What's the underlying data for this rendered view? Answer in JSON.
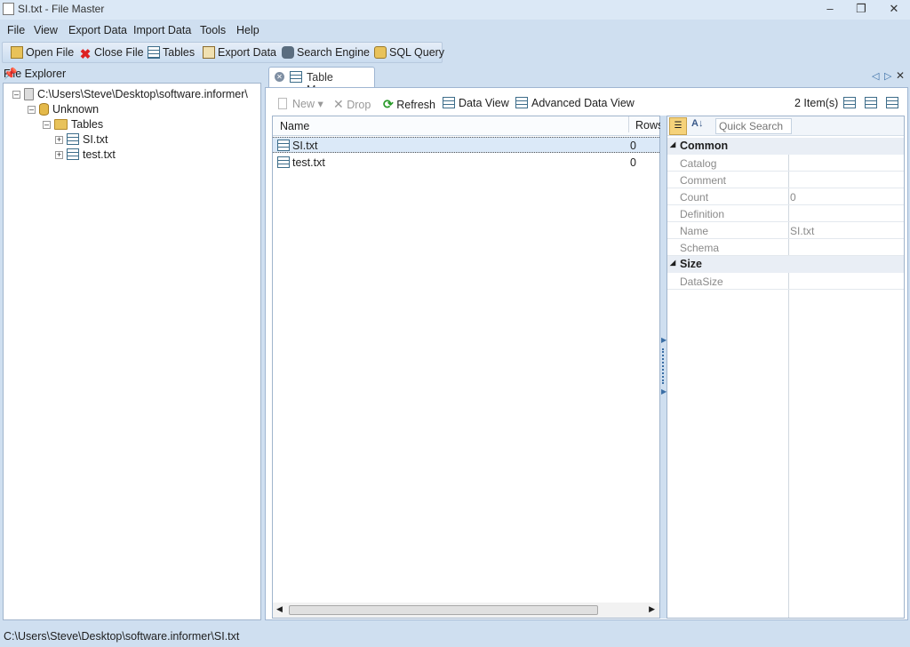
{
  "window": {
    "title": "SI.txt - File Master"
  },
  "menu": [
    "File",
    "View",
    "Export Data",
    "Import Data",
    "Tools",
    "Help"
  ],
  "toolbar": {
    "open_file": "Open File",
    "close_file": "Close File",
    "tables": "Tables",
    "export_data": "Export Data",
    "search_engine": "Search Engine",
    "sql_query": "SQL Query"
  },
  "file_explorer": {
    "title": "File Explorer",
    "root": "C:\\Users\\Steve\\Desktop\\software.informer\\",
    "db": "Unknown",
    "folder": "Tables",
    "items": [
      "SI.txt",
      "test.txt"
    ]
  },
  "tab": {
    "label": "Table Manager"
  },
  "subtoolbar": {
    "new": "New",
    "drop": "Drop",
    "refresh": "Refresh",
    "data_view": "Data View",
    "advanced_data_view": "Advanced Data View",
    "count": "2 Item(s)"
  },
  "grid": {
    "columns": [
      "Name",
      "Rows"
    ],
    "rows": [
      {
        "name": "SI.txt",
        "rows": "0"
      },
      {
        "name": "test.txt",
        "rows": "0"
      }
    ]
  },
  "properties": {
    "search_placeholder": "Quick Search",
    "categories": [
      {
        "name": "Common",
        "rows": [
          {
            "k": "Catalog",
            "v": ""
          },
          {
            "k": "Comment",
            "v": ""
          },
          {
            "k": "Count",
            "v": "0"
          },
          {
            "k": "Definition",
            "v": ""
          },
          {
            "k": "Name",
            "v": "SI.txt"
          },
          {
            "k": "Schema",
            "v": ""
          }
        ]
      },
      {
        "name": "Size",
        "rows": [
          {
            "k": "DataSize",
            "v": ""
          }
        ]
      }
    ]
  },
  "status": {
    "path": "C:\\Users\\Steve\\Desktop\\software.informer\\SI.txt"
  }
}
